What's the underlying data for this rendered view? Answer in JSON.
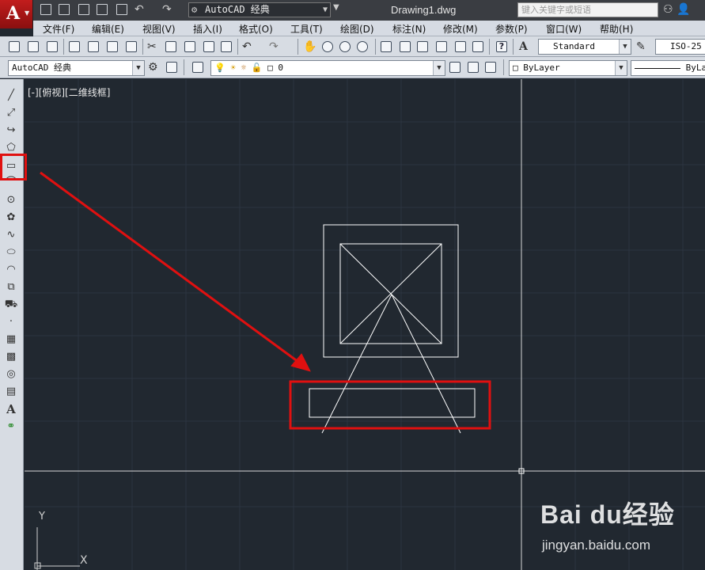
{
  "titlebar": {
    "workspace": "AutoCAD 经典",
    "document_title": "Drawing1.dwg",
    "search_placeholder": "键入关键字或短语"
  },
  "menu": [
    "文件(F)",
    "编辑(E)",
    "视图(V)",
    "插入(I)",
    "格式(O)",
    "工具(T)",
    "绘图(D)",
    "标注(N)",
    "修改(M)",
    "参数(P)",
    "窗口(W)",
    "帮助(H)"
  ],
  "toolbar": {
    "text_style": "Standard",
    "dim_style": "ISO-25",
    "workspace_combo": "AutoCAD 经典",
    "layer_value": "0",
    "color_value": "ByLayer",
    "linetype_value": "ByLa"
  },
  "canvas": {
    "viewport_label": "[-][俯视][二维线框]",
    "ucs_y": "Y",
    "ucs_x": "X",
    "colors": {
      "background": "#212830",
      "lines": "#ffffff",
      "highlight": "#e01010"
    }
  },
  "left_tools": [
    "line-icon",
    "construction-line-icon",
    "polyline-icon",
    "polygon-icon",
    "rectangle-icon",
    "arc-icon",
    "circle-icon",
    "revision-cloud-icon",
    "spline-icon",
    "ellipse-icon",
    "ellipse-arc-icon",
    "insert-block-icon",
    "make-block-icon",
    "point-icon",
    "hatch-icon",
    "gradient-icon",
    "region-icon",
    "table-icon",
    "mtext-icon",
    "add-selected-icon"
  ],
  "watermark": {
    "brand": "Bai du经验",
    "url": "jingyan.baidu.com"
  }
}
